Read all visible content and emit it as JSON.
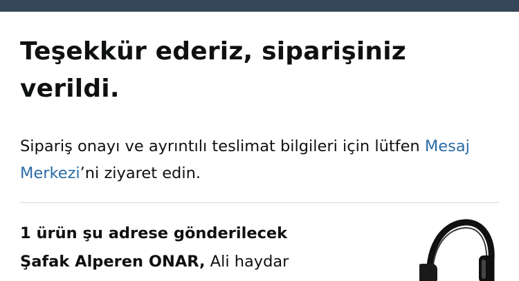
{
  "confirmation": {
    "title": "Teşekkür ederiz, siparişiniz verildi.",
    "message_before_link": "Sipariş onayı ve ayrıntılı teslimat bilgileri için lütfen ",
    "message_link": "Mesaj Merkezi",
    "message_after_link": "’ni ziyaret edin."
  },
  "shipping": {
    "heading": "1 ürün şu adrese gönderilecek",
    "recipient_name": "Şafak Alperen ONAR,",
    "address_start": " Ali haydar"
  },
  "product": {
    "image_icon": "headphones-icon"
  }
}
